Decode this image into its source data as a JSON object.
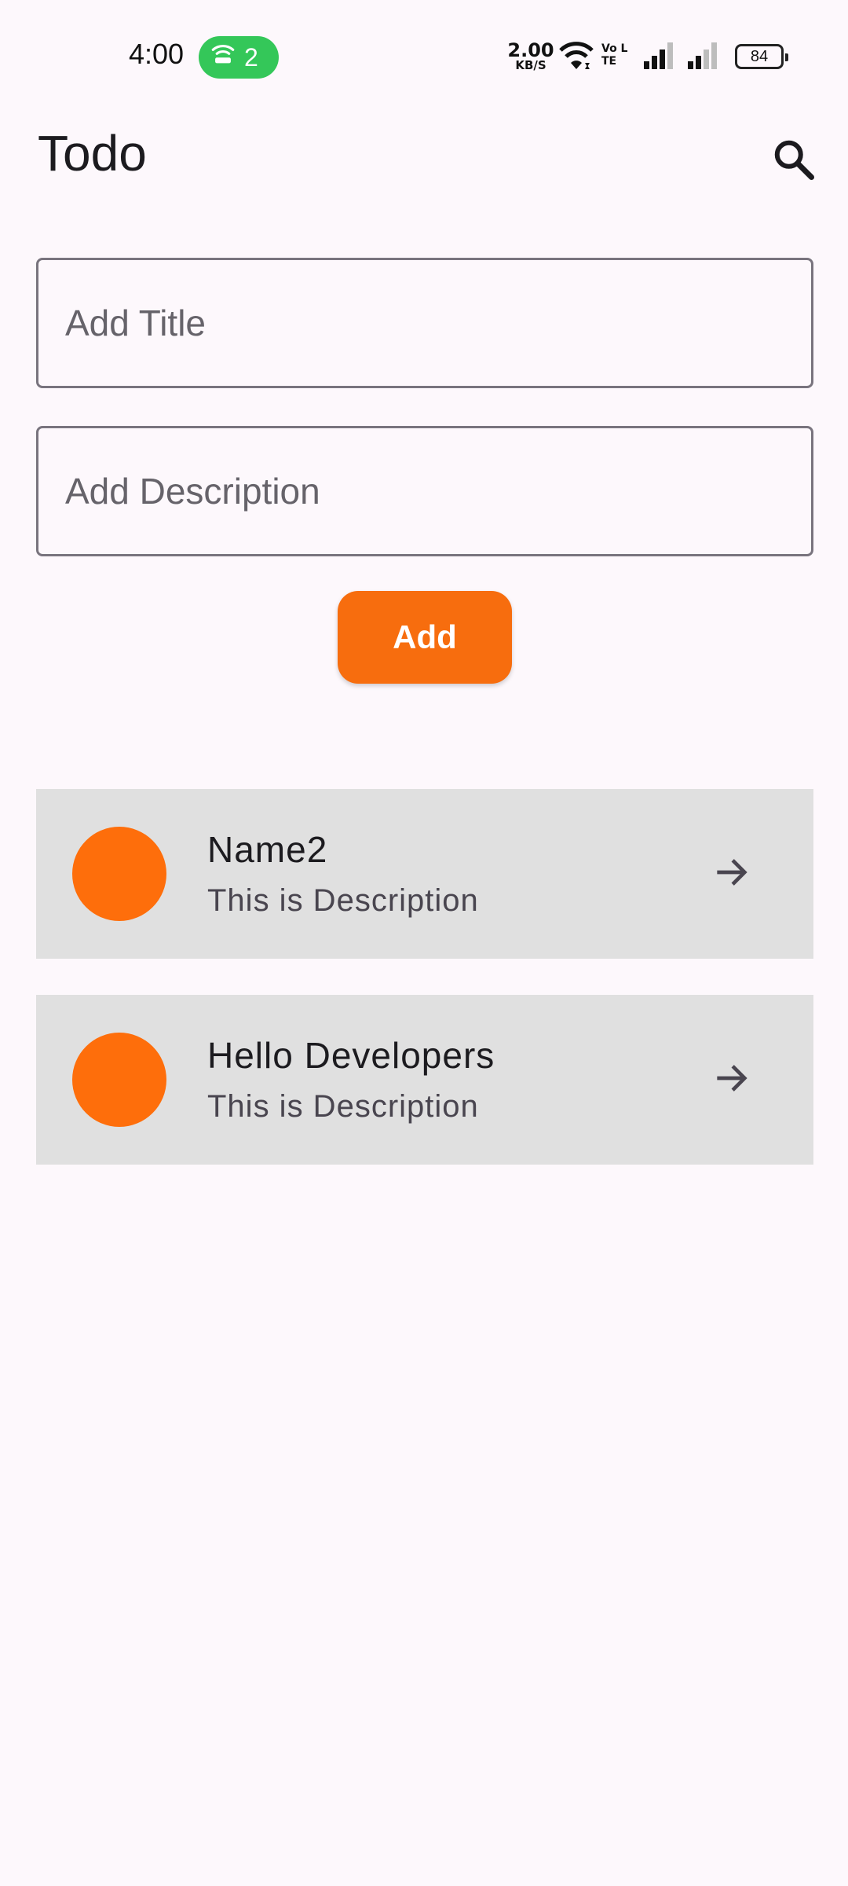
{
  "status_bar": {
    "time": "4:00",
    "hotspot_count": "2",
    "net_speed_value": "2.00",
    "net_speed_unit": "KB/S",
    "volte_label": "Vo LTE",
    "battery_level": "84",
    "icons": [
      "hotspot-icon",
      "wifi-icon",
      "volte-icon",
      "signal-icon",
      "signal-icon",
      "battery-icon"
    ]
  },
  "app_bar": {
    "title": "Todo",
    "search_icon": "search-icon"
  },
  "form": {
    "title_placeholder": "Add Title",
    "title_value": "",
    "description_placeholder": "Add Description",
    "description_value": "",
    "add_label": "Add"
  },
  "todos": [
    {
      "title": "Name2",
      "description": "This is Description"
    },
    {
      "title": "Hello Developers",
      "description": "This is Description"
    }
  ],
  "colors": {
    "accent": "#f76d0e",
    "avatar": "#fe6e0b",
    "list_item_bg": "#e0e0e0",
    "background": "#fdf8fc"
  }
}
